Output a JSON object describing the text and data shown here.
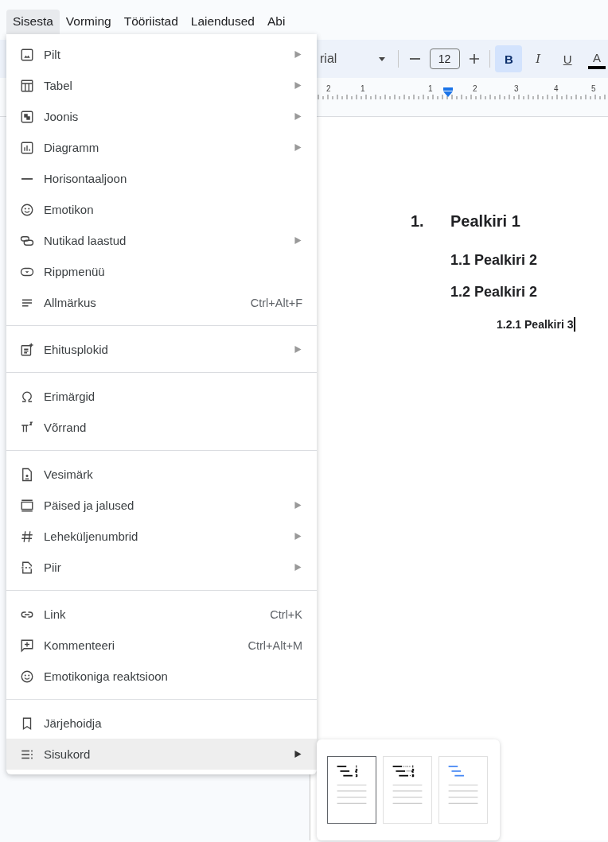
{
  "menu_bar": [
    {
      "label": "Sisesta",
      "selected": true
    },
    {
      "label": "Vorming",
      "selected": false
    },
    {
      "label": "Tööriistad",
      "selected": false
    },
    {
      "label": "Laiendused",
      "selected": false
    },
    {
      "label": "Abi",
      "selected": false
    }
  ],
  "toolbar": {
    "font": "rial",
    "font_size": "12",
    "buttons": [
      {
        "label": "B",
        "kind": "bold",
        "on": true
      },
      {
        "label": "I",
        "kind": "italic",
        "on": false
      },
      {
        "label": "U",
        "kind": "underline",
        "on": false
      },
      {
        "label": "A",
        "kind": "text-color",
        "on": false
      }
    ]
  },
  "ruler": {
    "labels": [
      "2",
      "1",
      "1",
      "2",
      "3",
      "4",
      "5"
    ]
  },
  "document": {
    "headings": [
      {
        "kind": "h1",
        "number": "1.",
        "text": "Pealkiri 1"
      },
      {
        "kind": "h2",
        "text": "1.1 Pealkiri 2"
      },
      {
        "kind": "h2",
        "text": "1.2 Pealkiri 2"
      },
      {
        "kind": "h3",
        "text": "1.2.1 Pealkiri 3"
      }
    ]
  },
  "insert_menu": {
    "sections": [
      {
        "items": [
          {
            "label": "Pilt",
            "submenu": true,
            "selected": false
          },
          {
            "label": "Tabel",
            "submenu": true,
            "selected": false
          },
          {
            "label": "Joonis",
            "submenu": true,
            "selected": false
          },
          {
            "label": "Diagramm",
            "submenu": true,
            "selected": false
          },
          {
            "label": "Horisontaaljoon",
            "submenu": false,
            "selected": false
          },
          {
            "label": "Emotikon",
            "submenu": false,
            "selected": false
          },
          {
            "label": "Nutikad laastud",
            "submenu": true,
            "selected": false
          },
          {
            "label": "Rippmenüü",
            "submenu": false,
            "selected": false
          },
          {
            "label": "Allmärkus",
            "shortcut": "Ctrl+Alt+F",
            "submenu": false,
            "selected": false
          }
        ]
      },
      {
        "items": [
          {
            "label": "Ehitusplokid",
            "submenu": true,
            "selected": false
          }
        ]
      },
      {
        "items": [
          {
            "label": "Erimärgid",
            "submenu": false,
            "selected": false
          },
          {
            "label": "Võrrand",
            "submenu": false,
            "selected": false
          }
        ]
      },
      {
        "items": [
          {
            "label": "Vesimärk",
            "submenu": false,
            "selected": false
          },
          {
            "label": "Päised ja jalused",
            "submenu": true,
            "selected": false
          },
          {
            "label": "Leheküljenumbrid",
            "submenu": true,
            "selected": false
          },
          {
            "label": "Piir",
            "submenu": true,
            "selected": false
          }
        ]
      },
      {
        "items": [
          {
            "label": "Link",
            "shortcut": "Ctrl+K",
            "submenu": false,
            "selected": false
          },
          {
            "label": "Kommenteeri",
            "shortcut": "Ctrl+Alt+M",
            "submenu": false,
            "selected": false
          },
          {
            "label": "Emotikoniga reaktsioon",
            "submenu": false,
            "selected": false
          }
        ]
      },
      {
        "items": [
          {
            "label": "Järjehoidja",
            "submenu": false,
            "selected": false
          },
          {
            "label": "Sisukord",
            "submenu": true,
            "selected": true
          }
        ]
      }
    ]
  },
  "toc_submenu": {
    "options": [
      {
        "kind": "numbered",
        "selected": true
      },
      {
        "kind": "dotted",
        "selected": false
      },
      {
        "kind": "links",
        "selected": false
      }
    ]
  }
}
